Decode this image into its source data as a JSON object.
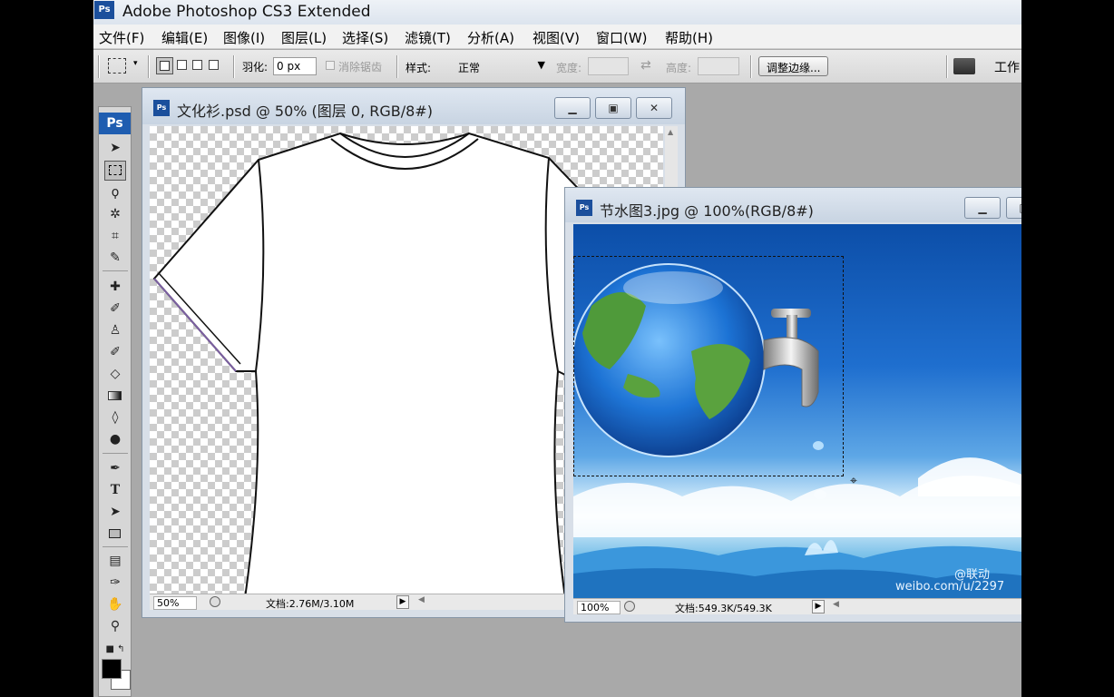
{
  "window": {
    "title": "Adobe Photoshop CS3 Extended",
    "logo_text": "Ps"
  },
  "menu": [
    "文件(F)",
    "编辑(E)",
    "图像(I)",
    "图层(L)",
    "选择(S)",
    "滤镜(T)",
    "分析(A)",
    "视图(V)",
    "窗口(W)",
    "帮助(H)"
  ],
  "options": {
    "feather_label": "羽化:",
    "feather_value": "0 px",
    "antialias_label": "消除锯齿",
    "style_label": "样式:",
    "style_value": "正常",
    "width_label": "宽度:",
    "height_label": "高度:",
    "refine_edge_label": "调整边缘...",
    "workspace_label": "工作!"
  },
  "toolbox": {
    "badge": "Ps"
  },
  "doc1": {
    "title": "文化衫.psd @ 50% (图层 0, RGB/8#)",
    "zoom": "50%",
    "doc_info": "文档:2.76M/3.10M",
    "icon_text": "Ps"
  },
  "doc2": {
    "title": "节水图3.jpg @ 100%(RGB/8#)",
    "zoom": "100%",
    "doc_info": "文档:549.3K/549.3K",
    "icon_text": "Ps",
    "watermark_top": "@联动",
    "watermark": "weibo.com/u/2297"
  },
  "colors": {
    "photoshop_blue": "#1f5db0",
    "foreground": "#000000",
    "background": "#ffffff"
  }
}
